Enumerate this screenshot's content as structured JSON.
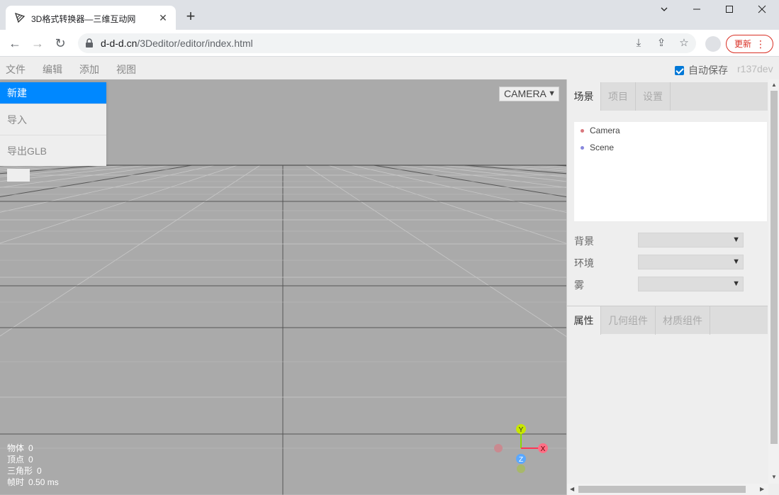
{
  "browser": {
    "tab_title": "3D格式转换器—三维互动网",
    "new_tab": "+",
    "url_host": "d-d-d.cn",
    "url_path": "/3Deditor/editor/index.html",
    "update_label": "更新"
  },
  "menubar": {
    "items": [
      "文件",
      "编辑",
      "添加",
      "视图"
    ],
    "autosave_label": "自动保存",
    "version": "r137dev"
  },
  "file_menu": {
    "items": [
      "新建",
      "导入",
      "导出GLB"
    ]
  },
  "viewport": {
    "camera_select": "CAMERA",
    "info": [
      {
        "label": "物体",
        "value": "0"
      },
      {
        "label": "顶点",
        "value": "0"
      },
      {
        "label": "三角形",
        "value": "0"
      },
      {
        "label": "帧时",
        "value": "0.50 ms"
      }
    ],
    "gizmo": {
      "y": "Y",
      "x": "X",
      "z": "Z"
    }
  },
  "sidebar": {
    "top_tabs": [
      "场景",
      "项目",
      "设置"
    ],
    "outliner": [
      {
        "name": "Camera",
        "color": "#d9777d"
      },
      {
        "name": "Scene",
        "color": "#8888dd"
      }
    ],
    "scene_props": [
      "背景",
      "环境",
      "雾"
    ],
    "bottom_tabs": [
      "属性",
      "几何组件",
      "材质组件"
    ]
  },
  "colors": {
    "accent": "#0088ff",
    "viewport_bg": "#aaaaaa",
    "gizmo_x": "#ff3653",
    "gizmo_y": "#8adb00",
    "gizmo_z": "#2c8fff"
  }
}
